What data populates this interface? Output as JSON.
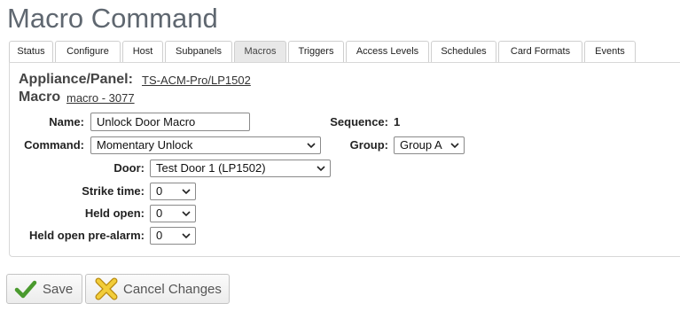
{
  "page": {
    "title": "Macro Command"
  },
  "tabs": [
    {
      "label": "Status",
      "active": false
    },
    {
      "label": "Configure",
      "active": false
    },
    {
      "label": "Host",
      "active": false
    },
    {
      "label": "Subpanels",
      "active": false
    },
    {
      "label": "Macros",
      "active": true
    },
    {
      "label": "Triggers",
      "active": false
    },
    {
      "label": "Access Levels",
      "active": false
    },
    {
      "label": "Schedules",
      "active": false
    },
    {
      "label": "Card Formats",
      "active": false
    },
    {
      "label": "Events",
      "active": false
    }
  ],
  "header": {
    "appliance_label": "Appliance/Panel:",
    "appliance_link": "TS-ACM-Pro/LP1502",
    "macro_label": "Macro",
    "macro_link": "macro - 3077"
  },
  "form": {
    "name_label": "Name:",
    "name_value": "Unlock Door Macro",
    "sequence_label": "Sequence:",
    "sequence_value": "1",
    "command_label": "Command:",
    "command_value": "Momentary Unlock",
    "group_label": "Group:",
    "group_value": "Group A",
    "door_label": "Door:",
    "door_value": "Test Door 1 (LP1502)",
    "strike_label": "Strike time:",
    "strike_value": "0",
    "held_open_label": "Held open:",
    "held_open_value": "0",
    "prealarm_label": "Held open pre-alarm:",
    "prealarm_value": "0"
  },
  "actions": {
    "save_label": "Save",
    "cancel_label": "Cancel Changes"
  },
  "icons": {
    "save": "checkmark-icon",
    "cancel": "x-cross-icon",
    "dropdown": "chevron-down-icon"
  },
  "colors": {
    "title": "#5f6770",
    "save_check": "#4a9a2e",
    "cancel_x": "#e0b830",
    "active_tab_bg": "#e8e8e8"
  }
}
